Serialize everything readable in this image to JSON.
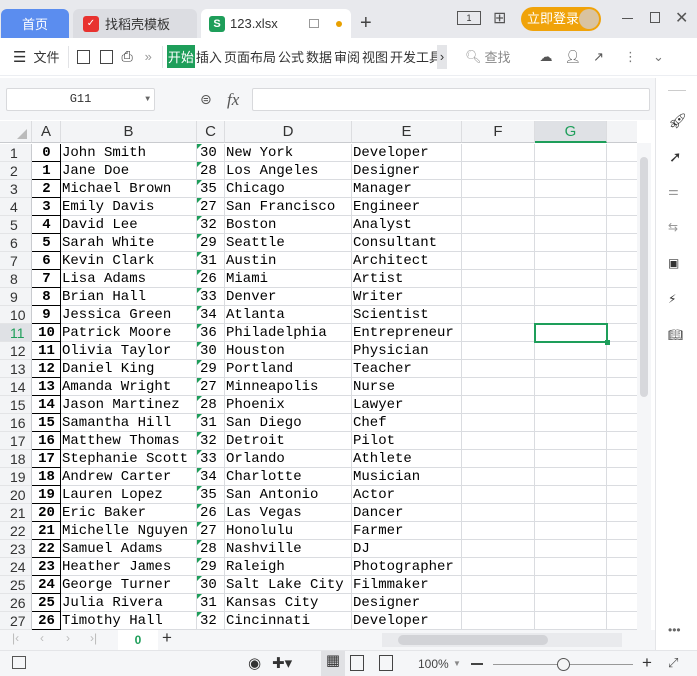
{
  "tabs": {
    "home": "首页",
    "template": "找稻壳模板",
    "file": "123.xlsx"
  },
  "titlebar": {
    "login": "立即登录"
  },
  "toolbar": {
    "menu": "文件",
    "ribbon": [
      "开始",
      "插入",
      "页面布局",
      "公式",
      "数据",
      "审阅",
      "视图",
      "开发工具"
    ],
    "search": "查找"
  },
  "formula": {
    "cell_ref": "G11",
    "fx": "fx",
    "value": ""
  },
  "columns": [
    "A",
    "B",
    "C",
    "D",
    "E",
    "F",
    "G"
  ],
  "selected_cell": "G11",
  "rows": [
    [
      "0",
      "John Smith",
      "30",
      "New York",
      "Developer"
    ],
    [
      "1",
      "Jane Doe",
      "28",
      "Los Angeles",
      "Designer"
    ],
    [
      "2",
      "Michael Brown",
      "35",
      "Chicago",
      "Manager"
    ],
    [
      "3",
      "Emily Davis",
      "27",
      "San Francisco",
      "Engineer"
    ],
    [
      "4",
      "David Lee",
      "32",
      "Boston",
      "Analyst"
    ],
    [
      "5",
      "Sarah White",
      "29",
      "Seattle",
      "Consultant"
    ],
    [
      "6",
      "Kevin Clark",
      "31",
      "Austin",
      "Architect"
    ],
    [
      "7",
      "Lisa Adams",
      "26",
      "Miami",
      "Artist"
    ],
    [
      "8",
      "Brian Hall",
      "33",
      "Denver",
      "Writer"
    ],
    [
      "9",
      "Jessica Green",
      "34",
      "Atlanta",
      "Scientist"
    ],
    [
      "10",
      "Patrick Moore",
      "36",
      "Philadelphia",
      "Entrepreneur"
    ],
    [
      "11",
      "Olivia Taylor",
      "30",
      "Houston",
      "Physician"
    ],
    [
      "12",
      "Daniel King",
      "29",
      "Portland",
      "Teacher"
    ],
    [
      "13",
      "Amanda Wright",
      "27",
      "Minneapolis",
      "Nurse"
    ],
    [
      "14",
      "Jason Martinez",
      "28",
      "Phoenix",
      "Lawyer"
    ],
    [
      "15",
      "Samantha Hill",
      "31",
      "San Diego",
      "Chef"
    ],
    [
      "16",
      "Matthew Thomas",
      "32",
      "Detroit",
      "Pilot"
    ],
    [
      "17",
      "Stephanie Scott",
      "33",
      "Orlando",
      "Athlete"
    ],
    [
      "18",
      "Andrew Carter",
      "34",
      "Charlotte",
      "Musician"
    ],
    [
      "19",
      "Lauren Lopez",
      "35",
      "San Antonio",
      "Actor"
    ],
    [
      "20",
      "Eric Baker",
      "26",
      "Las Vegas",
      "Dancer"
    ],
    [
      "21",
      "Michelle Nguyen",
      "27",
      "Honolulu",
      "Farmer"
    ],
    [
      "22",
      "Samuel Adams",
      "28",
      "Nashville",
      "DJ"
    ],
    [
      "23",
      "Heather James",
      "29",
      "Raleigh",
      "Photographer"
    ],
    [
      "24",
      "George Turner",
      "30",
      "Salt Lake City",
      "Filmmaker"
    ],
    [
      "25",
      "Julia Rivera",
      "31",
      "Kansas City",
      "Designer"
    ],
    [
      "26",
      "Timothy Hall",
      "32",
      "Cincinnati",
      "Developer"
    ]
  ],
  "sheets": [
    "0"
  ],
  "status": {
    "zoom": "100%",
    "zoom_level_percent": 100
  },
  "colors": {
    "accent": "#1e9e5a",
    "home_tab": "#5b8def",
    "login": "#f0a30a"
  }
}
